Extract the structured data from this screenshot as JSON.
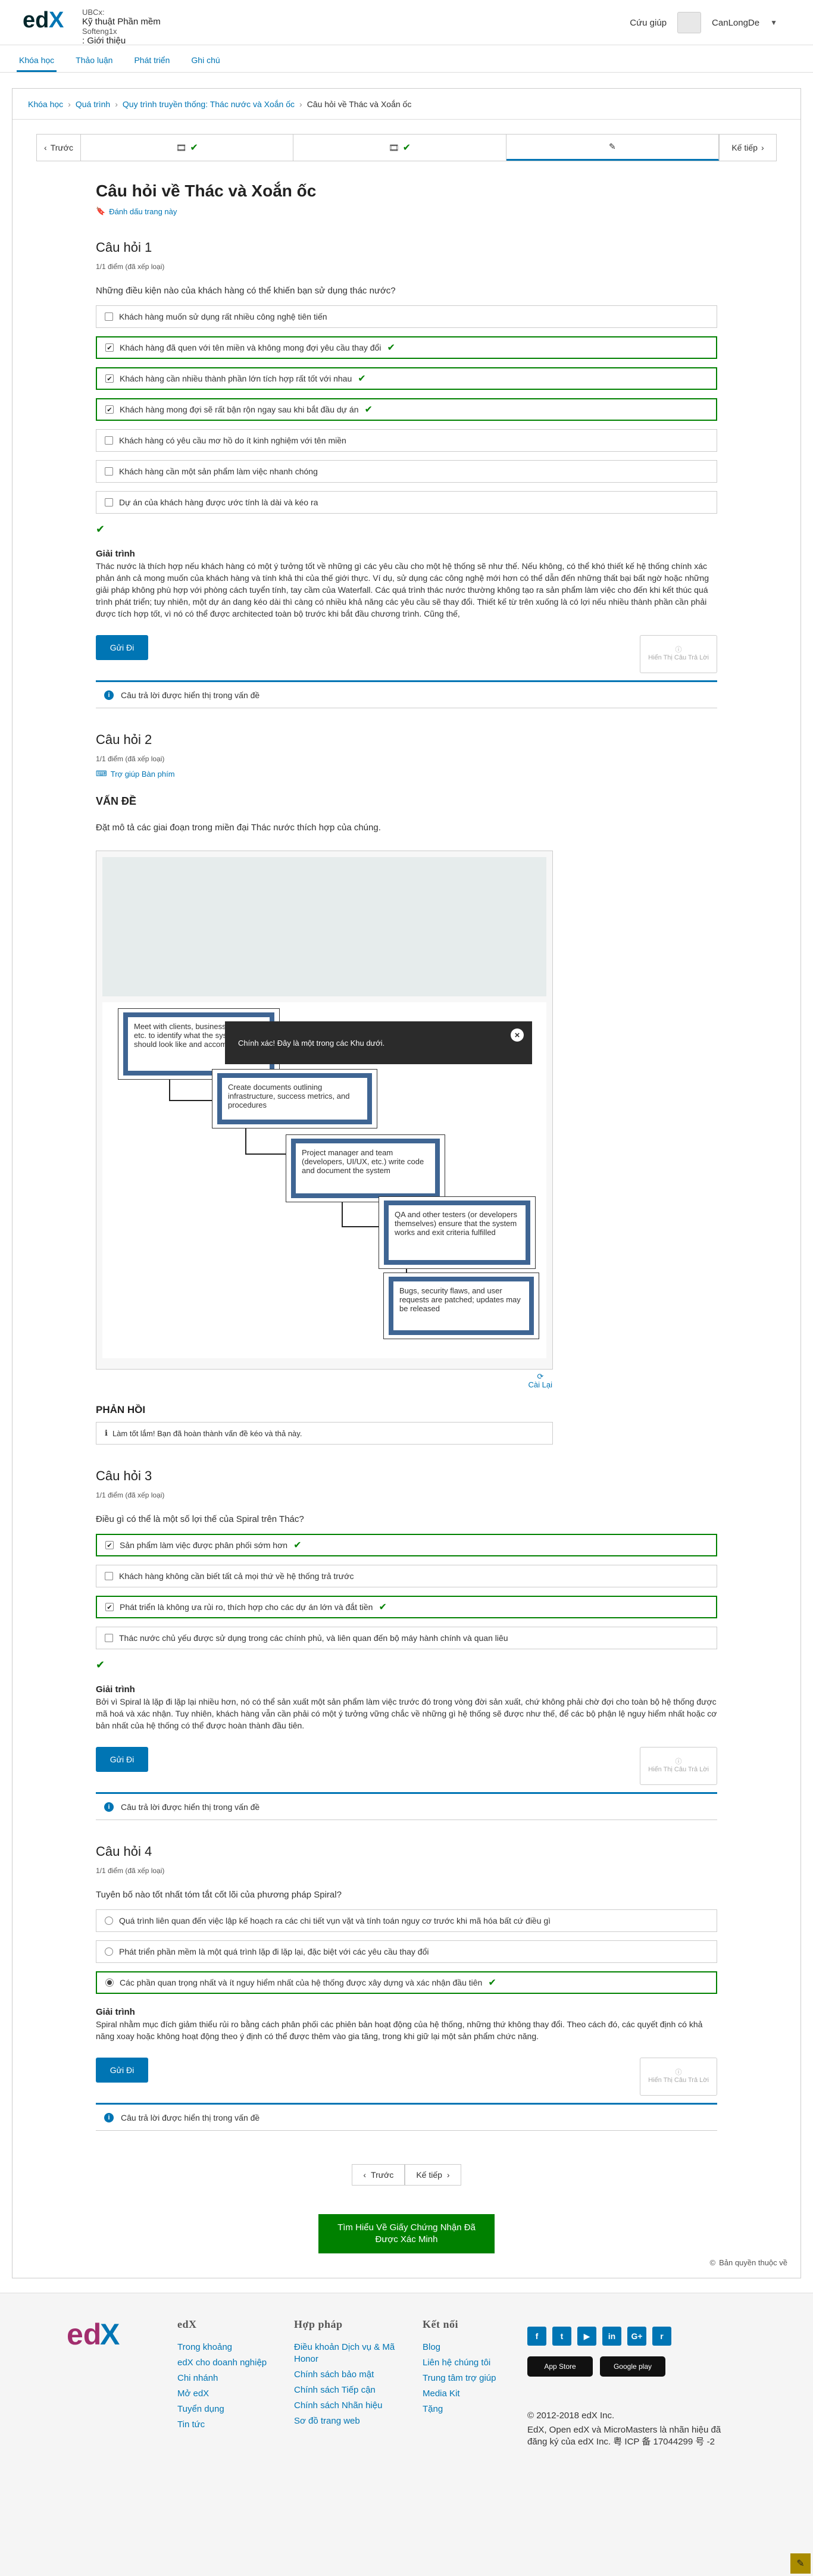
{
  "header": {
    "org_label": "UBCx:",
    "course_name": "Kỹ thuật Phần mềm",
    "course_code": "Softeng1x",
    "section": ": Giới thiệu",
    "help": "Cứu giúp",
    "username": "CanLongDe"
  },
  "tabs": [
    "Khóa học",
    "Thảo luận",
    "Phát triển",
    "Ghi chú"
  ],
  "breadcrumb": [
    "Khóa học",
    "Quá trình",
    "Quy trình truyền thống: Thác nước và Xoắn ốc",
    "Câu hỏi về Thác và Xoắn ốc"
  ],
  "seq": {
    "prev": "Trước",
    "next": "Kế tiếp"
  },
  "unit_title": "Câu hỏi về Thác và Xoắn ốc",
  "bookmark": "Đánh dấu trang này",
  "common": {
    "score": "1/1 điểm (đã xếp loại)",
    "submit": "Gửi Đi",
    "show_answer": "Hiển Thị Câu Trả Lời",
    "explanation_heading": "Giải trình",
    "notice": "Câu trả lời được hiển thị trong vấn đề"
  },
  "q1": {
    "title": "Câu hỏi 1",
    "stem": "Những điều kiện nào của khách hàng có thể khiến bạn sử dụng thác nước?",
    "options": [
      {
        "text": "Khách hàng muốn sử dụng rất nhiều công nghệ tiên tiến",
        "checked": false
      },
      {
        "text": "Khách hàng đã quen với tên miền và không mong đợi yêu cầu thay đổi",
        "checked": true
      },
      {
        "text": "Khách hàng cần nhiều thành phần lớn tích hợp rất tốt với nhau",
        "checked": true
      },
      {
        "text": "Khách hàng mong đợi sẽ rất bận rộn ngay sau khi bắt đầu dự án",
        "checked": true
      },
      {
        "text": "Khách hàng có yêu cầu mơ hồ do ít kinh nghiệm với tên miền",
        "checked": false
      },
      {
        "text": "Khách hàng cần một sản phẩm làm việc nhanh chóng",
        "checked": false
      },
      {
        "text": "Dự án của khách hàng được ước tính là dài và kéo ra",
        "checked": false
      }
    ],
    "explanation": "Thác nước là thích hợp nếu khách hàng có một ý tưởng tốt về những gì các yêu cầu cho một hệ thống sẽ như thế. Nếu không, có thể khó thiết kế hệ thống chính xác phản ánh cả mong muốn của khách hàng và tính khả thi của thế giới thực. Ví dụ, sử dụng các công nghệ mới hơn có thể dẫn đến những thất bại bất ngờ hoặc những giải pháp không phù hợp với phòng cách tuyển tính, tay cầm của Waterfall. Các quá trình thác nước thường không tạo ra sản phẩm làm việc cho đến khi kết thúc quá trình phát triển; tuy nhiên, một dự án dang kéo dài thì càng có nhiều khả năng các yêu cầu sẽ thay đổi. Thiết kế từ trên xuống là có lợi nếu nhiều thành phần cần phải được tích hợp tốt, vì nó có thể được architected toàn bộ trước khi bắt đầu chương trình. Cũng thế,"
  },
  "q2": {
    "title": "Câu hỏi 2",
    "hint": "Trợ giúp Bàn phím",
    "section": "VẤN ĐỀ",
    "stem": "Đặt mô tả các giai đoạn trong miền đại Thác nước thích hợp của chúng.",
    "steps": [
      "Meet with clients, business analysts, etc. to identify what the system should look like and accomplish",
      "Create documents outlining infrastructure, success metrics, and procedures",
      "Project manager and team (developers, UI/UX, etc.) write code and document the system",
      "QA and other testers (or developers themselves) ensure that the system works and exit criteria fulfilled",
      "Bugs, security flaws, and user requests are patched; updates may be released"
    ],
    "tooltip": "Chính xác! Đây là một trong các Khu dưới.",
    "reset": "Cài Lại",
    "feedback_heading": "PHẢN HỒI",
    "feedback": "Làm tốt lắm! Bạn đã hoàn thành vấn đề kéo và thả này."
  },
  "q3": {
    "title": "Câu hỏi 3",
    "stem": "Điều gì có thể là một số lợi thế của Spiral trên Thác?",
    "options": [
      {
        "text": "Sản phẩm làm việc được phân phối sớm hơn",
        "checked": true
      },
      {
        "text": "Khách hàng không cần biết tất cả mọi thứ về hệ thống trả trước",
        "checked": false
      },
      {
        "text": "Phát triển là không ưa rủi ro, thích hợp cho các dự án lớn và đắt tiền",
        "checked": true
      },
      {
        "text": "Thác nước chủ yếu được sử dụng trong các chính phủ, và liên quan đến bộ máy hành chính và quan liêu",
        "checked": false
      }
    ],
    "explanation": "Bởi vì Spiral là lặp đi lặp lại nhiều hơn, nó có thể sản xuất một sản phẩm làm việc trước đó trong vòng đời sản xuất, chứ không phải chờ đợi cho toàn bộ hệ thống được mã hoá và xác nhận. Tuy nhiên, khách hàng vẫn cần phải có một ý tưởng vững chắc về những gì hệ thống sẽ được như thế, để các bộ phận lệ nguy hiểm nhất hoặc cơ bản nhất của hệ thống có thể được hoàn thành đầu tiên."
  },
  "q4": {
    "title": "Câu hỏi 4",
    "stem": "Tuyên bố nào tốt nhất tóm tắt cốt lõi của phương pháp Spiral?",
    "options": [
      {
        "text": "Quá trình liên quan đến việc lập kế hoạch ra các chi tiết vụn vặt và tính toán nguy cơ trước khi mã hóa bất cứ điều gì",
        "checked": false
      },
      {
        "text": "Phát triển phần mềm là một quá trình lặp đi lặp lại, đặc biệt với các yêu cầu thay đổi",
        "checked": false
      },
      {
        "text": "Các phần quan trọng nhất và ít nguy hiểm nhất của hệ thống được xây dựng và xác nhận đầu tiên",
        "checked": true
      }
    ],
    "explanation": "Spiral nhằm mục đích giảm thiểu rủi ro bằng cách phân phối các phiên bản hoạt động của hệ thống, những thứ không thay đổi. Theo cách đó, các quyết định có khả năng xoay hoặc không hoạt động theo ý định có thể được thêm vào gia tăng, trong khi giữ lại một sản phẩm chức năng."
  },
  "bottom_nav": {
    "prev": "Trước",
    "next": "Kế tiếp"
  },
  "certificate": "Tìm Hiểu Về Giấy Chứng Nhận Đã Được Xác Minh",
  "copyright_notice": "Bản quyền thuộc về",
  "footer": {
    "col1": {
      "heading": "edX",
      "links": [
        "Trong khoảng",
        "edX cho doanh nghiệp",
        "Chi nhánh",
        "Mở edX",
        "Tuyển dụng",
        "Tin tức"
      ]
    },
    "col2": {
      "heading": "Hợp pháp",
      "links": [
        "Điều khoản Dịch vụ & Mã Honor",
        "Chính sách bảo mật",
        "Chính sách Tiếp cận",
        "Chính sách Nhãn hiệu",
        "Sơ đồ trang web"
      ]
    },
    "col3": {
      "heading": "Kết nối",
      "links": [
        "Blog",
        "Liên hệ chúng tôi",
        "Trung tâm trợ giúp",
        "Media Kit",
        "Tặng"
      ]
    },
    "social": [
      "f",
      "t",
      "▶",
      "in",
      "G+",
      "r"
    ],
    "store_apple": "App Store",
    "store_google": "Google play",
    "legal": [
      "© 2012-2018 edX Inc.",
      "EdX, Open edX và MicroMasters là nhãn hiệu đã đăng ký của edX Inc. 粤 ICP 备 17044299 号 -2"
    ]
  }
}
